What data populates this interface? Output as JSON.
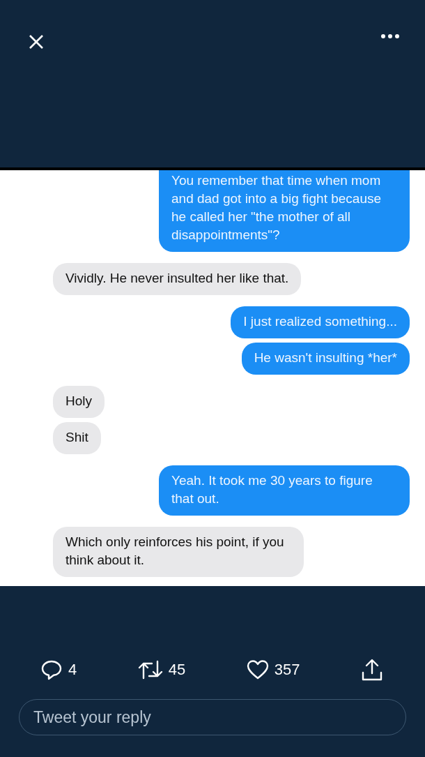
{
  "messages": [
    {
      "kind": "sent",
      "text": "You remember that time when mom and dad got into a big fight because he called her \"the mother of all disappointments\"?"
    },
    {
      "kind": "received",
      "text": "Vividly. He never insulted her like that."
    },
    {
      "kind": "sent",
      "text": "I just realized something..."
    },
    {
      "kind": "sent",
      "text": "He wasn't insulting *her*"
    },
    {
      "kind": "received",
      "text": "Holy"
    },
    {
      "kind": "received",
      "text": "Shit"
    },
    {
      "kind": "sent",
      "text": "Yeah. It took me 30 years to figure that out."
    },
    {
      "kind": "received",
      "text": "Which only reinforces his point, if you think about it."
    }
  ],
  "actions": {
    "replies": "4",
    "retweets": "45",
    "likes": "357"
  },
  "reply_field": {
    "placeholder": "Tweet your reply"
  }
}
